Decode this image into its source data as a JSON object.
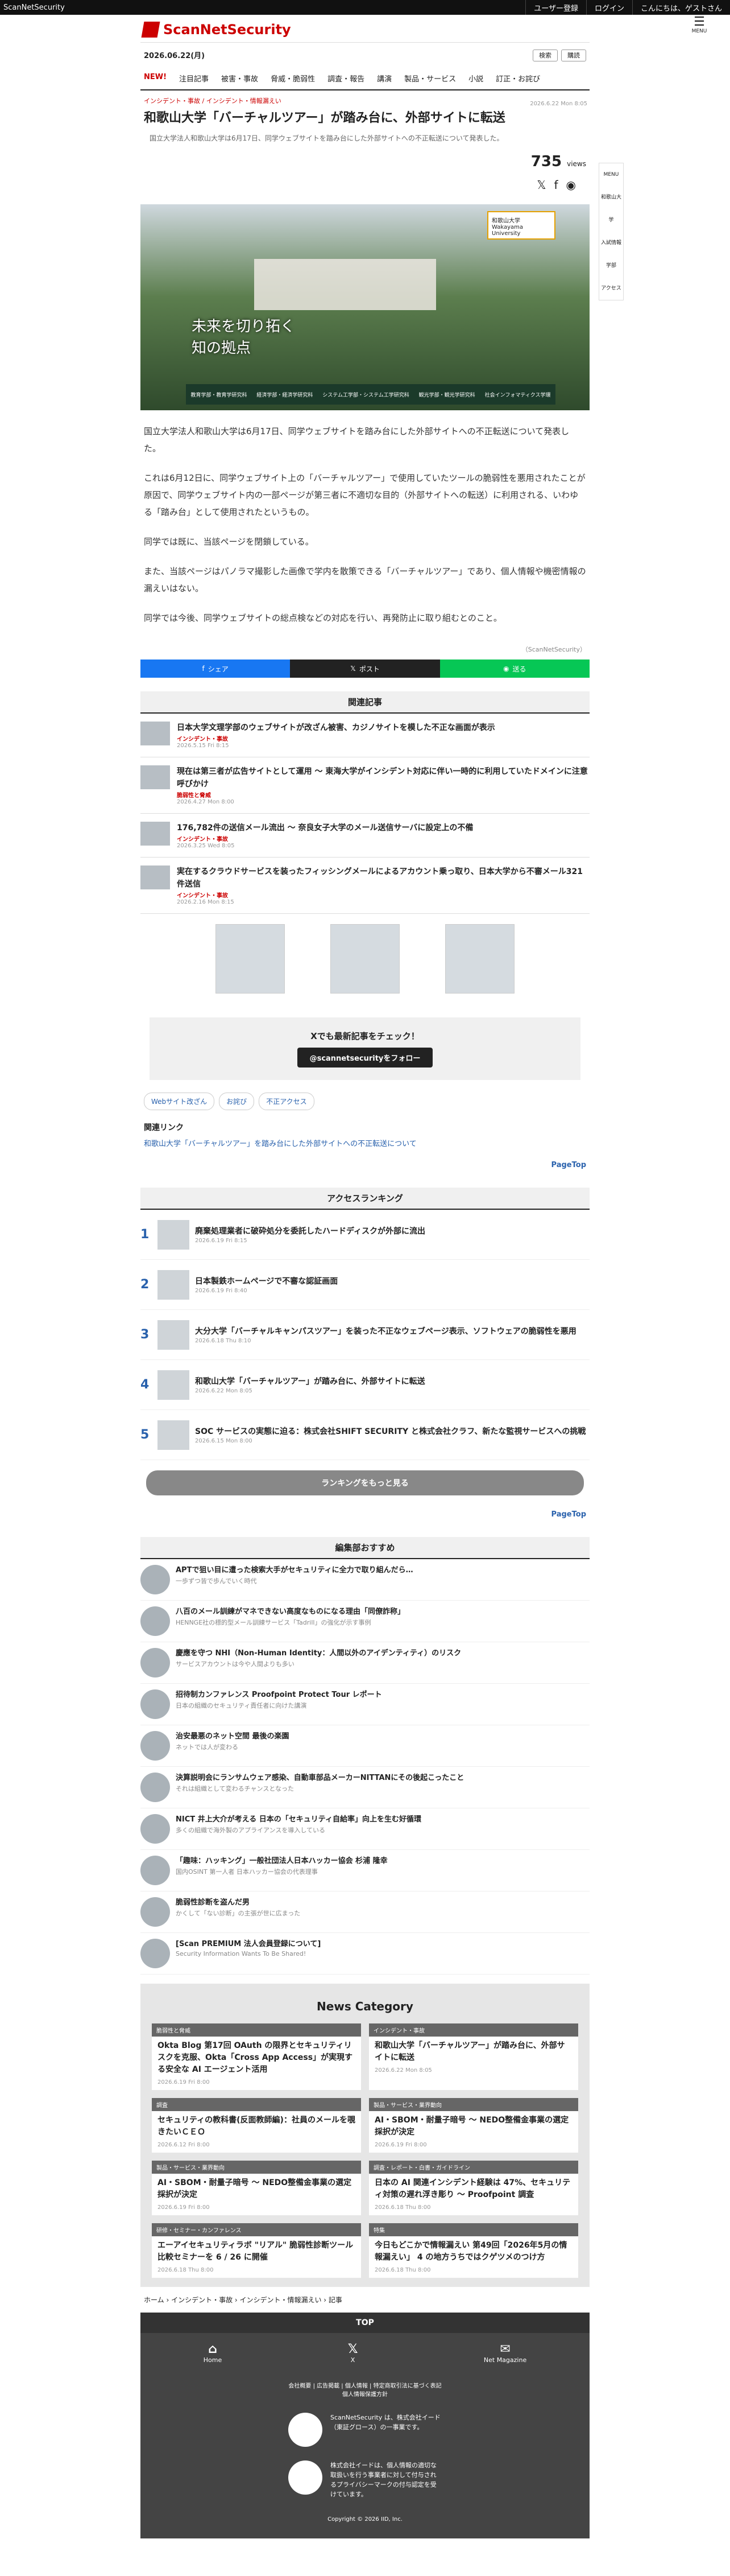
{
  "topbar": {
    "site": "ScanNetSecurity",
    "register": "ユーザー登録",
    "login": "ログイン",
    "hello": "こんにちは、ゲストさん"
  },
  "header": {
    "logo": "ScanNetSecurity",
    "menu": "MENU",
    "date": "2026.06.22(月)",
    "search": "検索",
    "subscribe": "購読"
  },
  "nav": [
    "NEW!",
    "注目記事",
    "被害・事故",
    "脅威・脆弱性",
    "調査・報告",
    "講演",
    "製品・サービス",
    "小説",
    "訂正・お詫び"
  ],
  "breadcrumb": "インシデント・事故 / インシデント・情報漏えい",
  "article": {
    "date": "2026.6.22 Mon 8:05",
    "title": "和歌山大学「バーチャルツアー」が踏み台に、外部サイトに転送",
    "lead": "国立大学法人和歌山大学は6月17日、同学ウェブサイトを踏み台にした外部サイトへの不正転送について発表した。",
    "views": "735",
    "views_label": "views",
    "hero_caption": [
      "未来を切り拓く",
      "知の拠点"
    ],
    "hero_badge": "和歌山大学 Wakayama University",
    "hero_strip": [
      "教育学部・教育学研究科",
      "経済学部・経済学研究科",
      "システム工学部・システム工学研究科",
      "観光学部・観光学研究科",
      "社会インフォマティクス学環"
    ],
    "paragraphs": [
      "国立大学法人和歌山大学は6月17日、同学ウェブサイトを踏み台にした外部サイトへの不正転送について発表した。",
      "これは6月12日に、同学ウェブサイト上の「バーチャルツアー」で使用していたツールの脆弱性を悪用されたことが原因で、同学ウェブサイト内の一部ページが第三者に不適切な目的（外部サイトへの転送）に利用される、いわゆる「踏み台」として使用されたというもの。",
      "同学では既に、当該ページを閉鎖している。",
      "また、当該ページはパノラマ撮影した画像で学内を散策できる「バーチャルツアー」であり、個人情報や機密情報の漏えいはない。",
      "同学では今後、同学ウェブサイトの総点検などの対応を行い、再発防止に取り組むとのこと。"
    ],
    "source": "（ScanNetSecurity）",
    "share": [
      "シェア",
      "ポスト",
      "送る"
    ]
  },
  "side": [
    "MENU",
    "和歌山大学",
    "入試情報",
    "学部",
    "アクセス"
  ],
  "related": {
    "title": "関連記事",
    "items": [
      {
        "t": "日本大学文理学部のウェブサイトが改ざん被害、カジノサイトを模した不正な画面が表示",
        "tag": "インシデント・事故",
        "d": "2026.5.15 Fri 8:15"
      },
      {
        "t": "現在は第三者が広告サイトとして運用 ～ 東海大学がインシデント対応に伴い一時的に利用していたドメインに注意呼びかけ",
        "tag": "脆弱性と脅威",
        "d": "2026.4.27 Mon 8:00"
      },
      {
        "t": "176,782件の送信メール流出 ～ 奈良女子大学のメール送信サーバに設定上の不備",
        "tag": "インシデント・事故",
        "d": "2026.3.25 Wed 8:05"
      },
      {
        "t": "実在するクラウドサービスを装ったフィッシングメールによるアカウント乗っ取り、日本大学から不審メール321件送信",
        "tag": "インシデント・事故",
        "d": "2026.2.16 Mon 8:15"
      }
    ]
  },
  "xbox": {
    "title": "Xでも最新記事をチェック！",
    "btn": "@scannetsecurityをフォロー"
  },
  "chips": [
    "Webサイト改ざん",
    "お詫び",
    "不正アクセス"
  ],
  "rellinks": {
    "title": "関連リンク",
    "link": "和歌山大学「バーチャルツアー」を踏み台にした外部サイトへの不正転送について"
  },
  "pagetop": "PageTop",
  "ranking": {
    "title": "アクセスランキング",
    "items": [
      {
        "n": "1",
        "t": "廃棄処理業者に破砕処分を委託したハードディスクが外部に流出",
        "d": "2026.6.19 Fri 8:15"
      },
      {
        "n": "2",
        "t": "日本製鉄ホームページで不審な認証画面",
        "d": "2026.6.19 Fri 8:40"
      },
      {
        "n": "3",
        "t": "大分大学「バーチャルキャンパスツアー」を装った不正なウェブページ表示、ソフトウェアの脆弱性を悪用",
        "d": "2026.6.18 Thu 8:10"
      },
      {
        "n": "4",
        "t": "和歌山大学「バーチャルツアー」が踏み台に、外部サイトに転送",
        "d": "2026.6.22 Mon 8:05"
      },
      {
        "n": "5",
        "t": "SOC サービスの実態に迫る：株式会社SHIFT SECURITY と株式会社クラフ、新たな監視サービスへの挑戦",
        "d": "2026.6.15 Mon 8:00"
      }
    ],
    "more": "ランキングをもっと見る"
  },
  "picks": {
    "title": "編集部おすすめ",
    "items": [
      {
        "t": "APTで狙い目に遭った検索大手がセキュリティに全力で取り組んだら…",
        "d": "一歩ずつ皆で歩んでいく時代"
      },
      {
        "t": "八百のメール訓練がマネできない高度なものになる理由「同僚詐称」",
        "d": "HENNGE社の標的型メール訓練サービス「Tadrill」の強化が示す事例"
      },
      {
        "t": "慶應を守つ NHI（Non-Human Identity：人間以外のアイデンティティ）のリスク",
        "d": "サービスアカウントは今や人間よりも多い"
      },
      {
        "t": "招待制カンファレンス Proofpoint Protect Tour レポート",
        "d": "日本の組織のセキュリティ責任者に向けた講演"
      },
      {
        "t": "治安最悪のネット空間 最後の楽園",
        "d": "ネットでは人が変わる"
      },
      {
        "t": "決算説明会にランサムウェア感染、自動車部品メーカーNITTANにその後起こったこと",
        "d": "それは組織として変わるチャンスとなった"
      },
      {
        "t": "NICT 井上大介が考える 日本の「セキュリティ自給率」向上を生む好循環",
        "d": "多くの組織で海外製のアプライアンスを導入している"
      },
      {
        "t": "「趣味：ハッキング」一般社団法人日本ハッカー協会 杉浦 隆幸",
        "d": "国内OSINT 第一人者 日本ハッカー協会の代表理事"
      },
      {
        "t": "脆弱性診断を盗んだ男",
        "d": "かくして「ない診断」の主張が世に広まった"
      },
      {
        "t": "[Scan PREMIUM 法人会員登録について]",
        "d": "Security Information Wants To Be Shared!"
      }
    ]
  },
  "news": {
    "title": "News Category",
    "items": [
      {
        "c": "脆弱性と脅威",
        "t": "Okta Blog 第17回 OAuth の限界とセキュリティリスクを克服、Okta「Cross App Access」が実現する安全な AI エージェント活用",
        "d": "2026.6.19 Fri 8:00"
      },
      {
        "c": "インシデント・事故",
        "t": "和歌山大学「バーチャルツアー」が踏み台に、外部サイトに転送",
        "d": "2026.6.22 Mon 8:05"
      },
      {
        "c": "調査",
        "t": "セキュリティの教科書(反面教師編)：社員のメールを覗きたいＣＥＯ",
        "d": "2026.6.12 Fri 8:00"
      },
      {
        "c": "製品・サービス・業界動向",
        "t": "AI・SBOM・耐量子暗号 ～ NEDO整備金事業の選定採択が決定",
        "d": "2026.6.19 Fri 8:00"
      },
      {
        "c": "製品・サービス・業界動向",
        "t": "AI・SBOM・耐量子暗号 ～ NEDO整備金事業の選定採択が決定",
        "d": "2026.6.19 Fri 8:00"
      },
      {
        "c": "調査・レポート・白書・ガイドライン",
        "t": "日本の AI 関連インシデント経験は 47%、セキュリティ対策の遅れ浮き彫り ～ Proofpoint 調査",
        "d": "2026.6.18 Thu 8:00"
      },
      {
        "c": "研修・セミナー・カンファレンス",
        "t": "エーアイセキュリティラボ \"リアル\" 脆弱性診断ツール比較セミナーを 6 / 26 に開催",
        "d": "2026.6.18 Thu 8:00"
      },
      {
        "c": "特集",
        "t": "今日もどこかで情報漏えい 第49回「2026年5月の情報漏えい」 4 の地方うちではクゲツメのつけ方",
        "d": "2026.6.18 Thu 8:00"
      }
    ]
  },
  "breadcrumb_foot": "ホーム › インシデント・事故 › インシデント・情報漏えい › 記事",
  "footer": {
    "top": "TOP",
    "icons": [
      "Home",
      "X",
      "Net Magazine"
    ],
    "links": "会社概要 | 広告掲載 | 個人情報 | 特定商取引法に基づく表記",
    "links2": "個人情報保護方針",
    "company": "ScanNetSecurity は、株式会社イード（東証グロース）の一事業です。",
    "company2": "株式会社イードは、個人情報の適切な取扱いを行う事業者に対して付与されるプライバシーマークの付与認定を受けています。",
    "copy": "Copyright © 2026 IID, Inc."
  }
}
